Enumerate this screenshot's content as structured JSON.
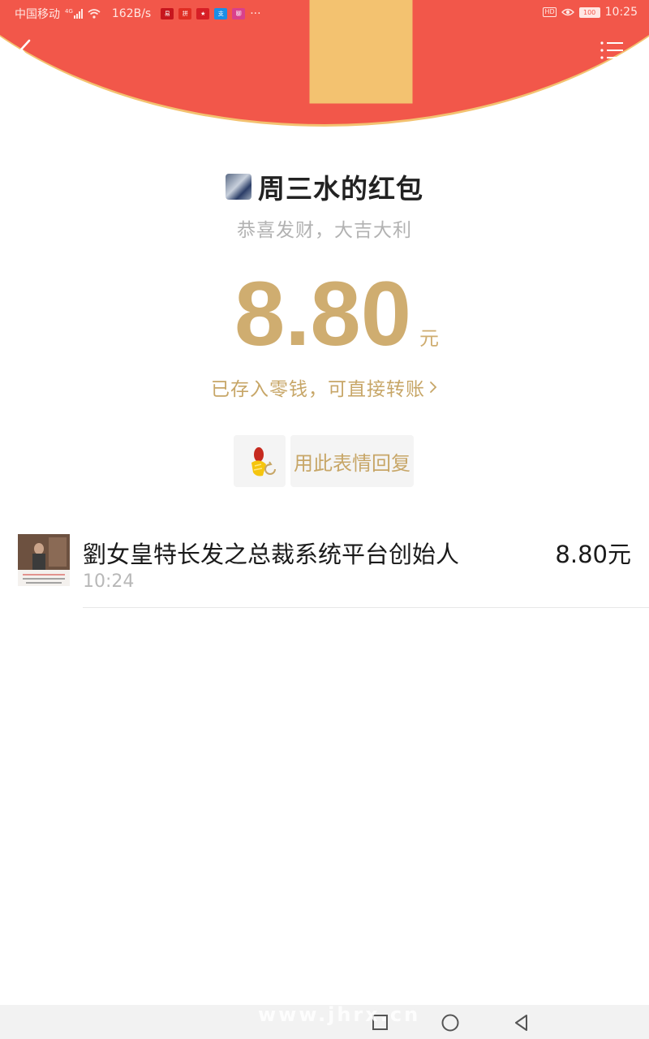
{
  "status_bar": {
    "carrier": "中国移动",
    "network": "4G",
    "speed": "162B/s",
    "app_icons": [
      {
        "name": "netease-icon",
        "color": "#c7161e"
      },
      {
        "name": "pinduoduo-icon",
        "color": "#e02e24"
      },
      {
        "name": "flag-icon",
        "color": "#d71f26"
      },
      {
        "name": "alipay-icon",
        "color": "#1b8ee5"
      },
      {
        "name": "weibo-icon",
        "color": "#d9408c"
      }
    ],
    "more": "···",
    "hd": "HD",
    "battery": "100",
    "time": "10:25"
  },
  "header": {
    "back_icon": "chevron-left-icon",
    "menu_icon": "list-menu-icon",
    "colors": {
      "arc": "#f2574a",
      "arc_edge": "#f3c270"
    }
  },
  "sender": {
    "name": "周三水的红包",
    "greeting": "恭喜发财，大吉大利"
  },
  "amount": {
    "value": "8.80",
    "unit": "元",
    "color": "#cfad70",
    "change_link": "已存入零钱，可直接转账"
  },
  "reply": {
    "label": "用此表情回复"
  },
  "receivers": [
    {
      "name": "劉女皇特长发之总裁系统平台创始人",
      "time": "10:24",
      "amount": "8.80元"
    }
  ],
  "watermark": "www.jhrx.cn",
  "nav_bar": {
    "buttons": [
      "square-icon",
      "circle-icon",
      "triangle-back-icon"
    ]
  }
}
